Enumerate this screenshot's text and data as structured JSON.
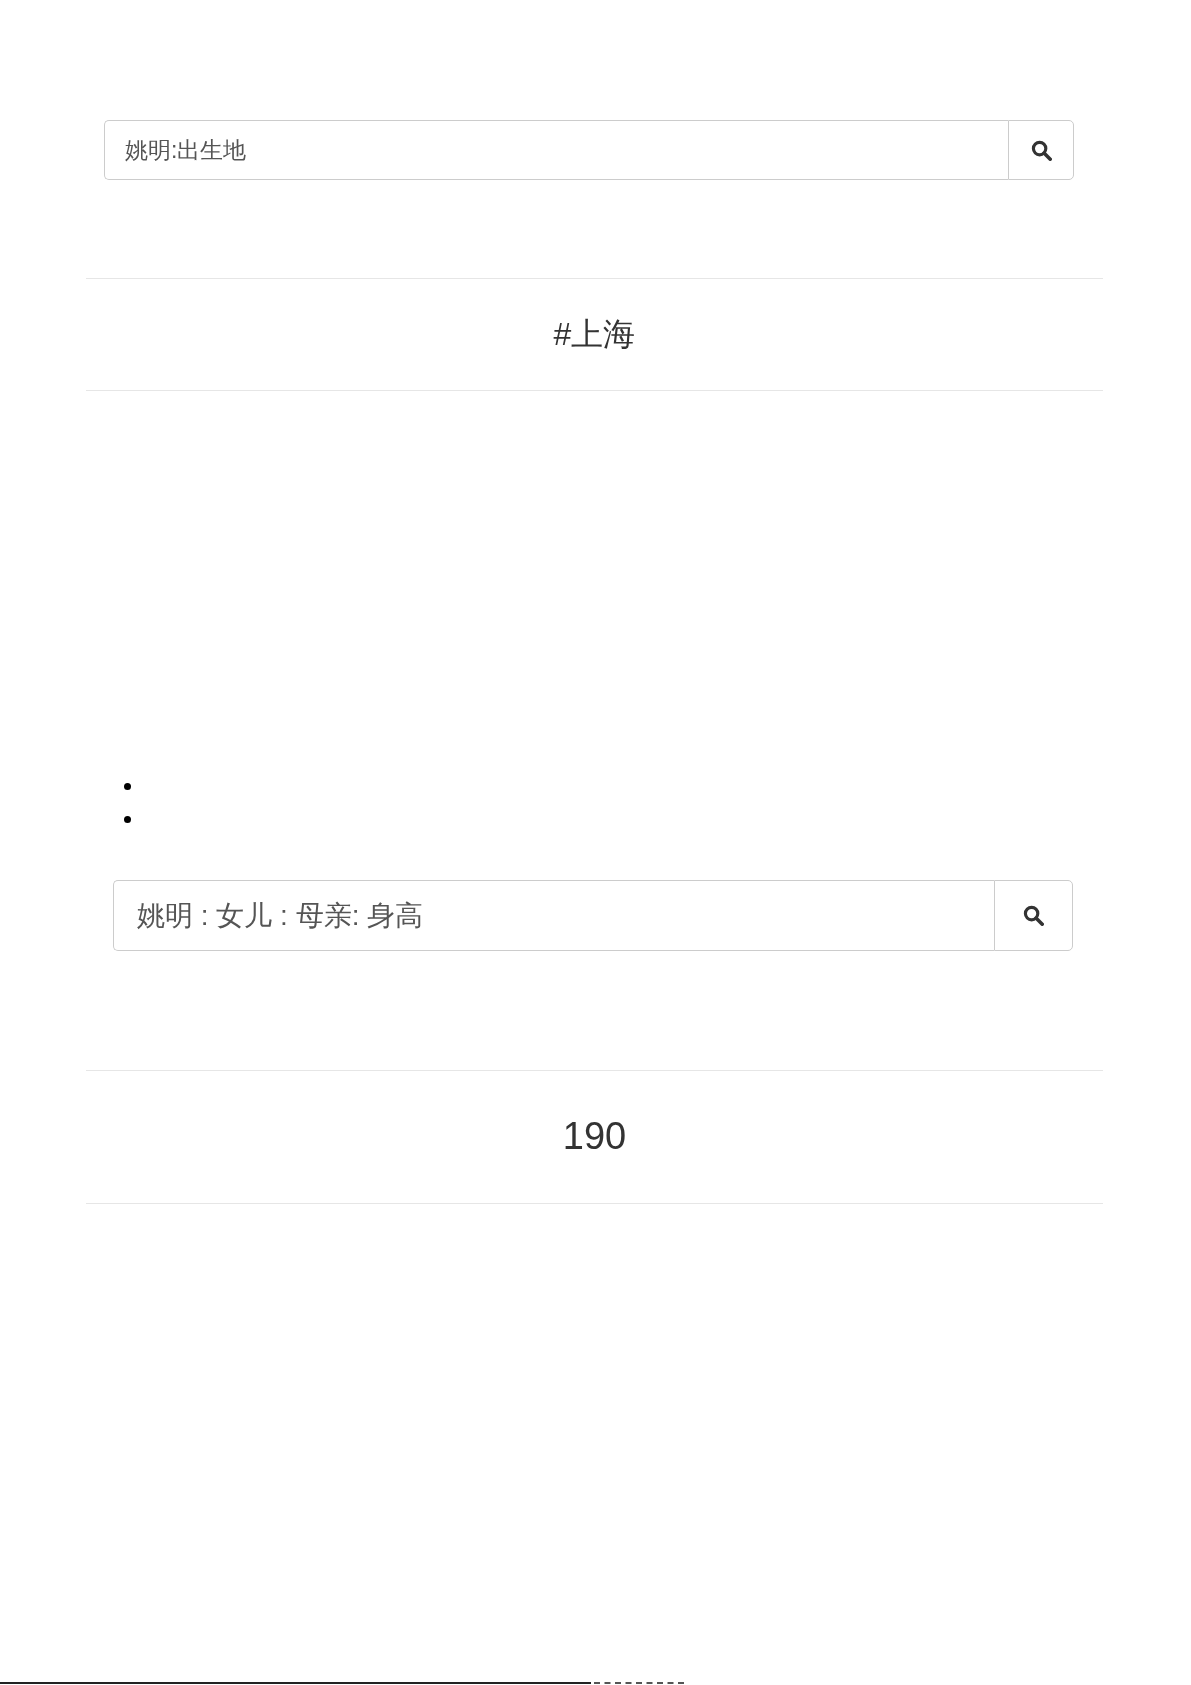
{
  "search_top": {
    "value": "姚明:出生地"
  },
  "answer_top": {
    "text": "#上海"
  },
  "bullet_list": [
    {
      "kind": "bullet"
    },
    {
      "kind": "bullet"
    }
  ],
  "search_bottom": {
    "value": "姚明 : 女儿 : 母亲: 身高"
  },
  "answer_bottom": {
    "text": "190"
  }
}
